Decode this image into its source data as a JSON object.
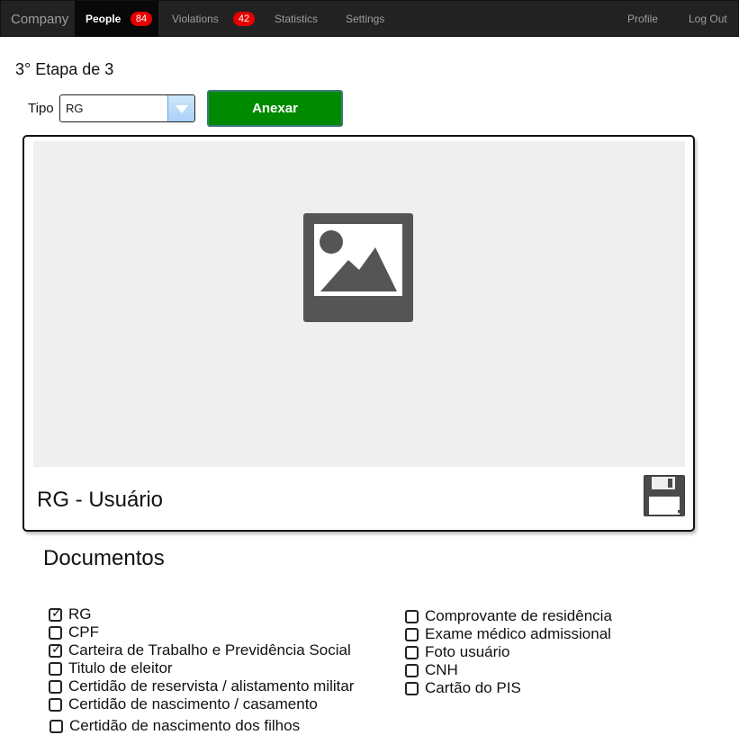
{
  "navbar": {
    "brand": "Company",
    "items": [
      {
        "label": "People",
        "badge": "84",
        "active": true
      },
      {
        "label": "Violations",
        "badge": "42",
        "active": false
      },
      {
        "label": "Statistics",
        "active": false
      },
      {
        "label": "Settings",
        "active": false
      }
    ],
    "right_items": [
      {
        "label": "Profile"
      },
      {
        "label": "Log Out"
      }
    ]
  },
  "step_title": "3° Etapa de 3",
  "form": {
    "tipo_label": "Tipo",
    "tipo_value": "RG",
    "attach_button": "Anexar"
  },
  "card": {
    "caption": "RG - Usuário",
    "image_icon": "image-placeholder-icon",
    "save_icon": "floppy-disk-icon"
  },
  "documents": {
    "title": "Documentos",
    "left_column": [
      {
        "label": "RG",
        "checked": true
      },
      {
        "label": "CPF",
        "checked": false
      },
      {
        "label": "Carteira de Trabalho e Previdência Social",
        "checked": true
      },
      {
        "label": "Titulo de eleitor",
        "checked": false
      },
      {
        "label": "Certidão de reservista / alistamento militar",
        "checked": false
      },
      {
        "label": "Certidão de nascimento / casamento",
        "checked": false
      }
    ],
    "last_item": {
      "label": "Certidão de nascimento dos filhos",
      "checked": false
    },
    "right_column": [
      {
        "label": "Comprovante de residência",
        "checked": false
      },
      {
        "label": "Exame médico admissional",
        "checked": false
      },
      {
        "label": "Foto usuário",
        "checked": false
      },
      {
        "label": "CNH",
        "checked": false
      },
      {
        "label": "Cartão do PIS",
        "checked": false
      }
    ]
  },
  "colors": {
    "navbar_bg": "#222222",
    "badge": "#e60000",
    "attach_button": "#008a00"
  }
}
